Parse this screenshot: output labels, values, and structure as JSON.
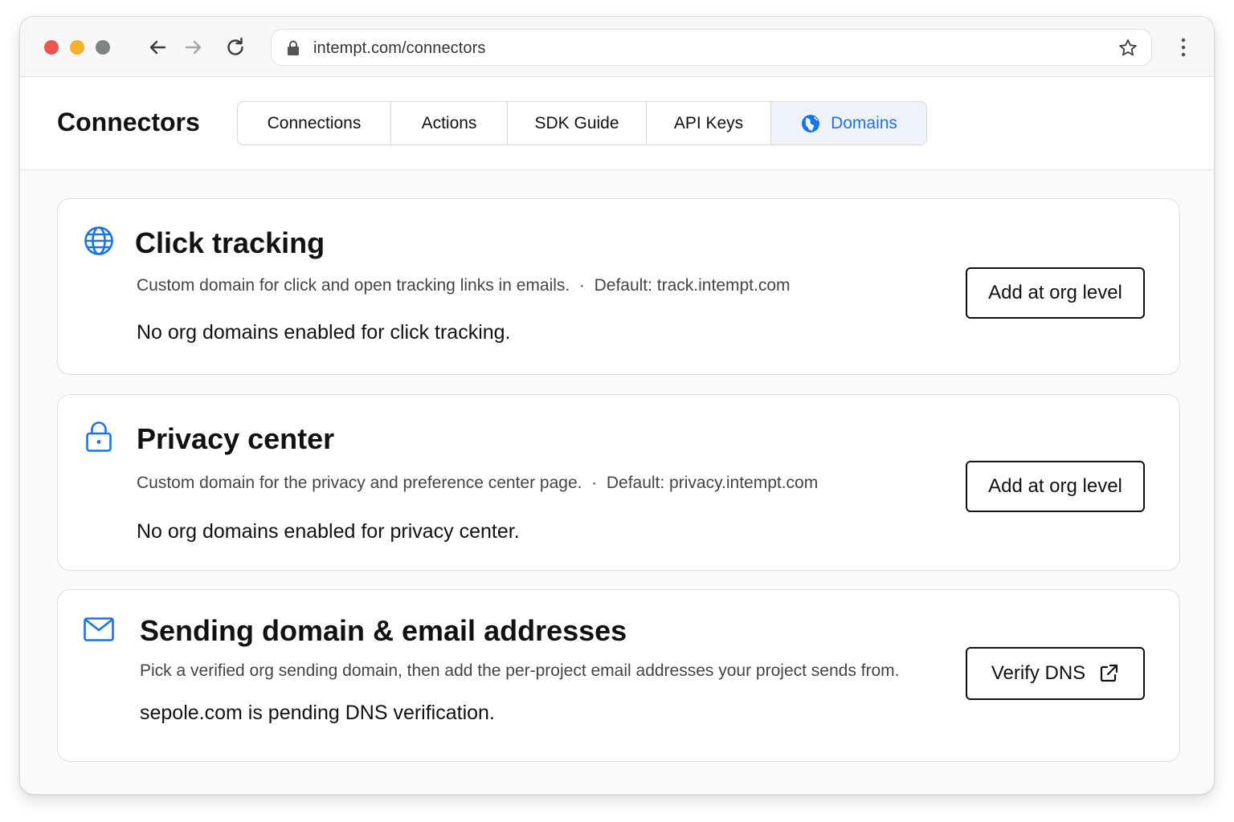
{
  "browser": {
    "url": "intempt.com/connectors"
  },
  "header": {
    "title": "Connectors",
    "tabs": [
      {
        "label": "Connections"
      },
      {
        "label": "Actions"
      },
      {
        "label": "SDK Guide"
      },
      {
        "label": "API Keys"
      },
      {
        "label": "Domains",
        "active": true,
        "icon": "globe-icon"
      }
    ]
  },
  "cards": {
    "click_tracking": {
      "icon": "globe-icon",
      "title": "Click tracking",
      "description": "Custom domain for click and open tracking links in emails.",
      "default": "Default: track.intempt.com",
      "status": "No org domains enabled for click tracking.",
      "button": "Add at org level"
    },
    "privacy_center": {
      "icon": "lock-icon",
      "title": "Privacy center",
      "description": "Custom domain for the privacy and preference center page.",
      "default": "Default: privacy.intempt.com",
      "status": "No org domains enabled for privacy center.",
      "button": "Add at org level"
    },
    "sending_domain": {
      "icon": "mail-icon",
      "title": "Sending domain & email addresses",
      "description": "Pick a verified org sending domain, then add the per-project email addresses your project sends from.",
      "status": "sepole.com is pending DNS verification.",
      "button": "Verify DNS",
      "button_icon": "external-link-icon"
    }
  },
  "colors": {
    "accent": "#1a73e8",
    "active_tab_bg": "#eef3fa"
  }
}
